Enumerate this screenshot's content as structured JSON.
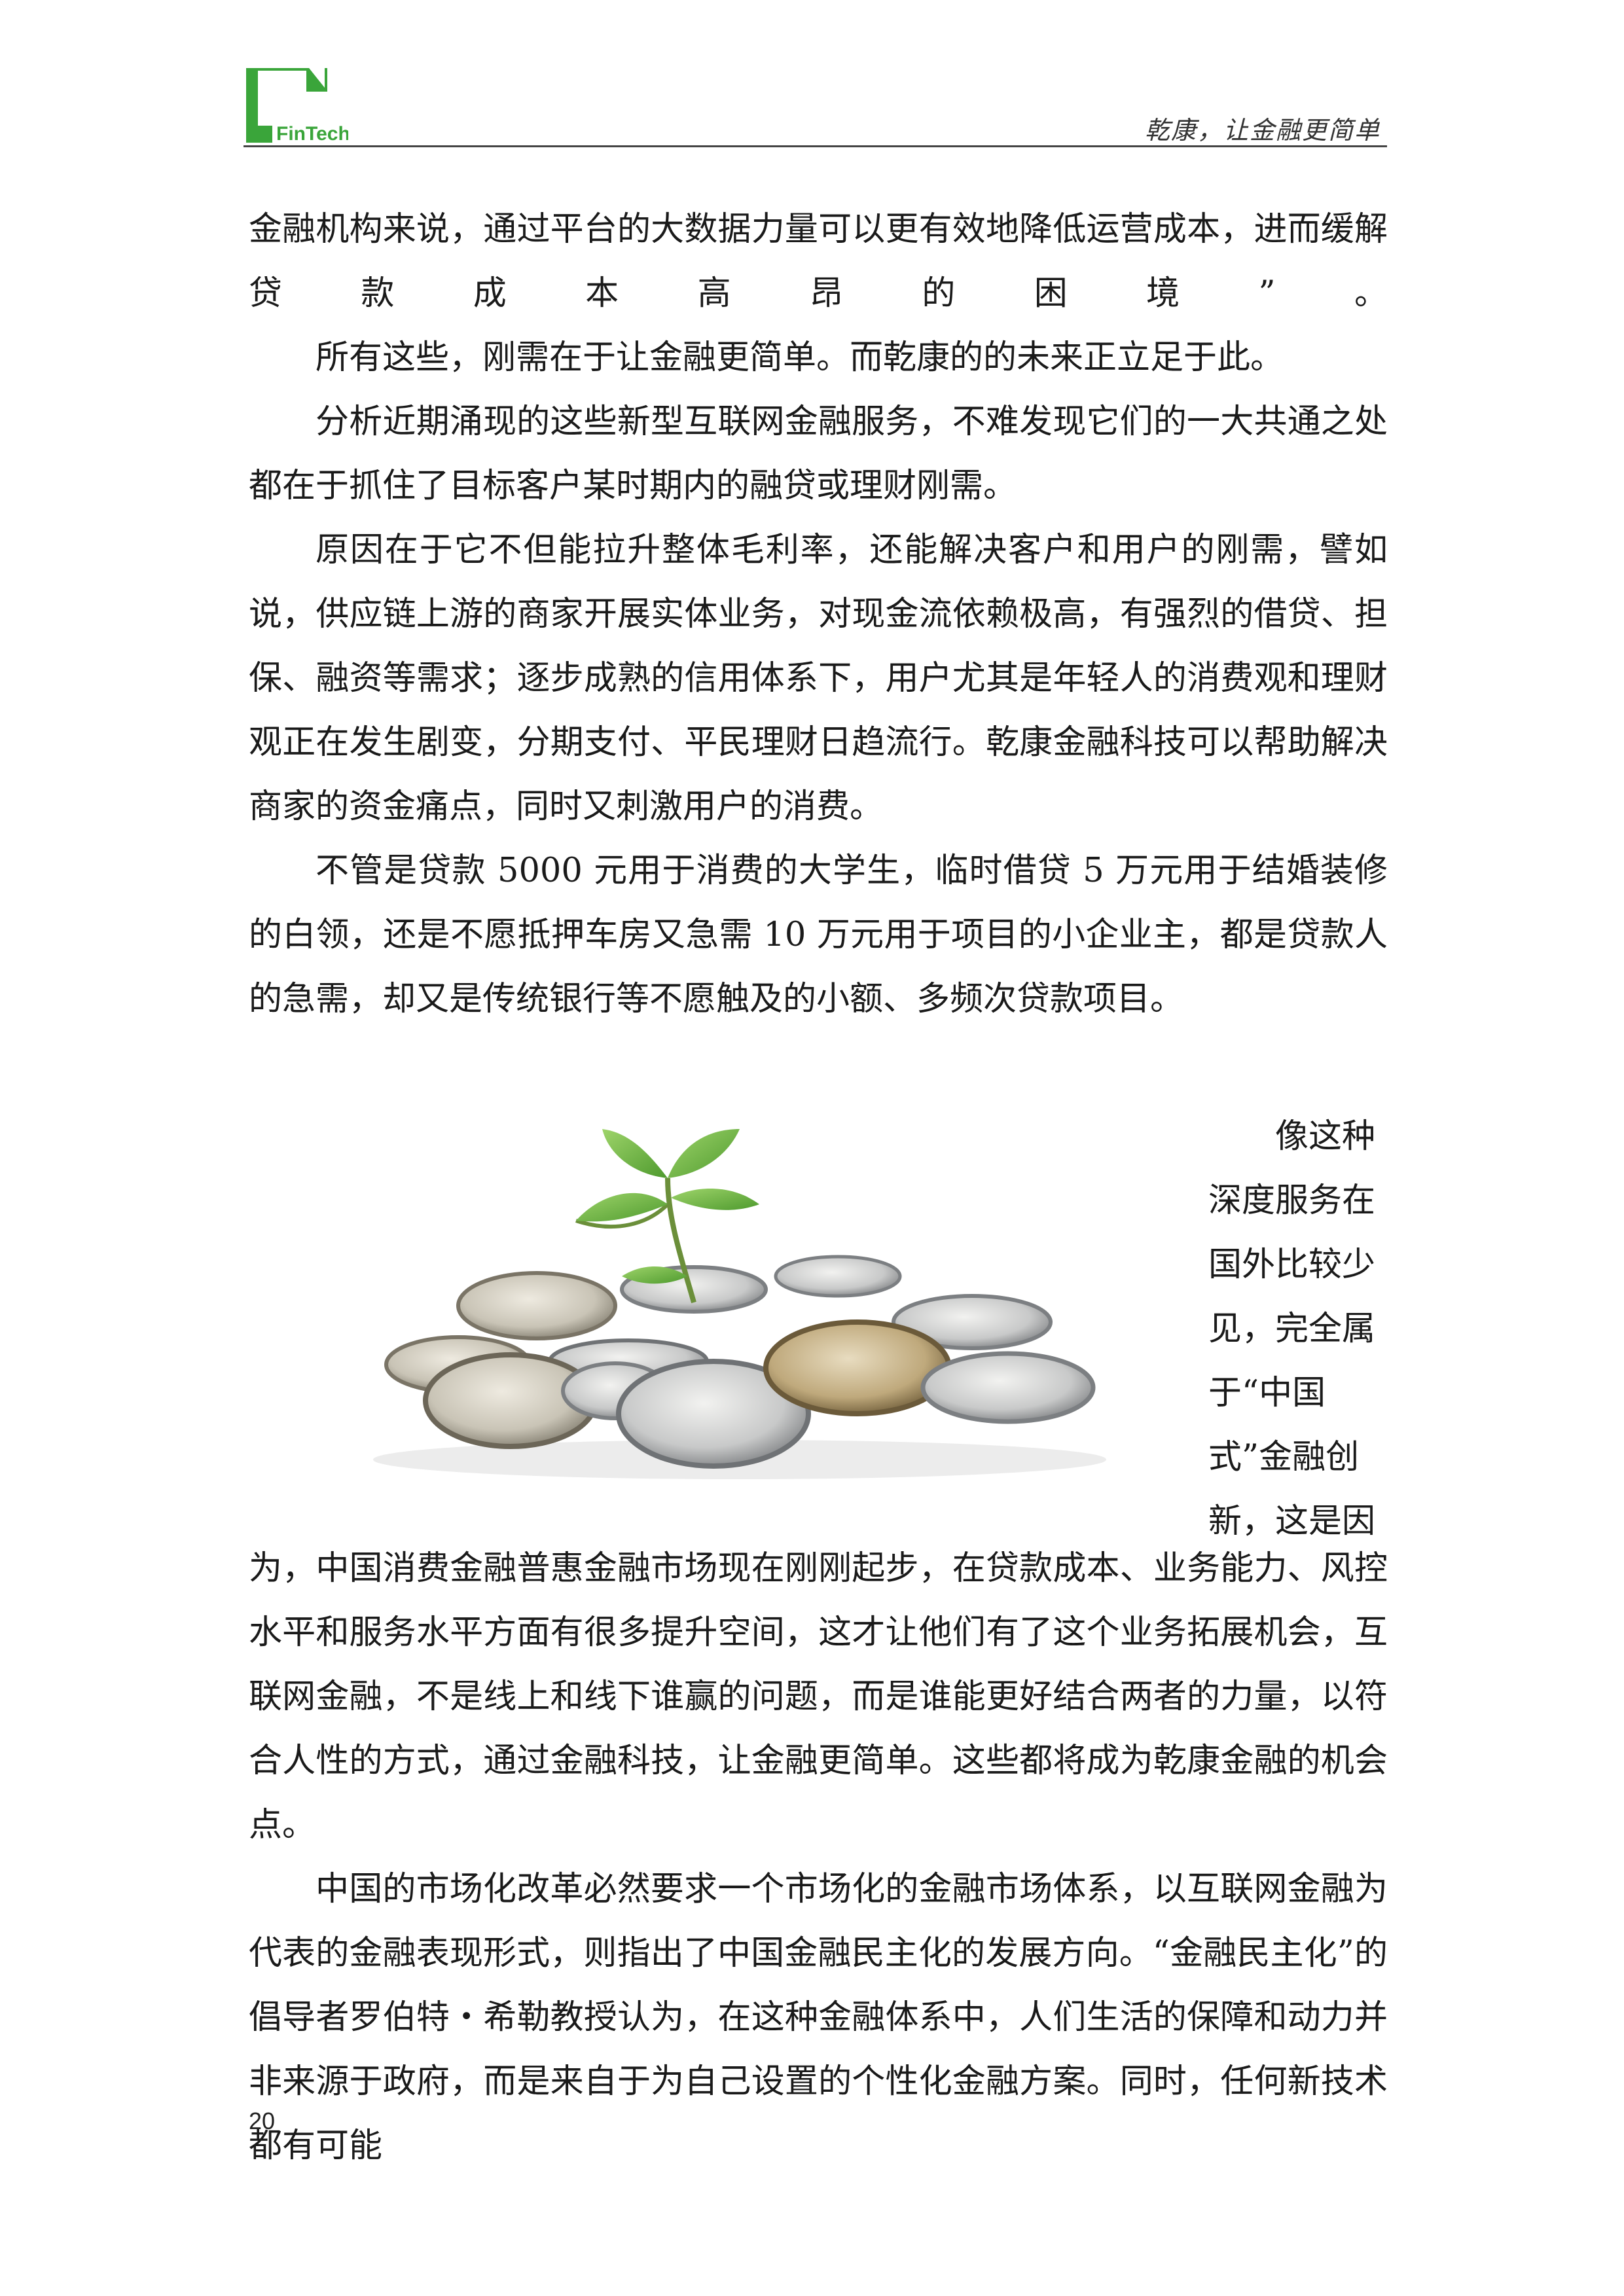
{
  "header": {
    "logo_text": "FinTech",
    "slogan": "乾康，让金融更简单",
    "brand_color": "#3aa53a"
  },
  "paragraphs_top": [
    "金融机构来说，通过平台的大数据力量可以更有效地降低运营成本，进而缓解贷款成本高昂的困境”。",
    "所有这些，刚需在于让金融更简单。而乾康的的未来正立足于此。",
    "分析近期涌现的这些新型互联网金融服务，不难发现它们的一大共通之处都在于抓住了目标客户某时期内的融贷或理财刚需。",
    "原因在于它不但能拉升整体毛利率，还能解决客户和用户的刚需，譬如说，供应链上游的商家开展实体业务，对现金流依赖极高，有强烈的借贷、担保、融资等需求；逐步成熟的信用体系下，用户尤其是年轻人的消费观和理财观正在发生剧变，分期支付、平民理财日趋流行。乾康金融科技可以帮助解决商家的资金痛点，同时又刺激用户的消费。",
    "不管是贷款 5000 元用于消费的大学生，临时借贷 5 万元用于结婚装修的白领，还是不愿抵押车房又急需 10 万元用于项目的小企业主，都是贷款人的急需，却又是传统银行等不愿触及的小额、多频次贷款项目。"
  ],
  "side_lines": [
    "像这种",
    "深度服务在",
    "国外比较少",
    "见，完全属",
    "于“中国",
    "式”金融创",
    "新，这是因"
  ],
  "paragraphs_bottom": [
    "为，中国消费金融普惠金融市场现在刚刚起步，在贷款成本、业务能力、风控水平和服务水平方面有很多提升空间，这才让他们有了这个业务拓展机会，互联网金融，不是线上和线下谁赢的问题，而是谁能更好结合两者的力量，以符合人性的方式，通过金融科技，让金融更简单。这些都将成为乾康金融的机会点。",
    "中国的市场化改革必然要求一个市场化的金融市场体系，以互联网金融为代表的金融表现形式，则指出了中国金融民主化的发展方向。“金融民主化”的倡导者罗伯特・希勒教授认为，在这种金融体系中，人们生活的保障和动力并非来源于政府，而是来自于为自己设置的个性化金融方案。同时，任何新技术都有可能"
  ],
  "page_number": "20"
}
